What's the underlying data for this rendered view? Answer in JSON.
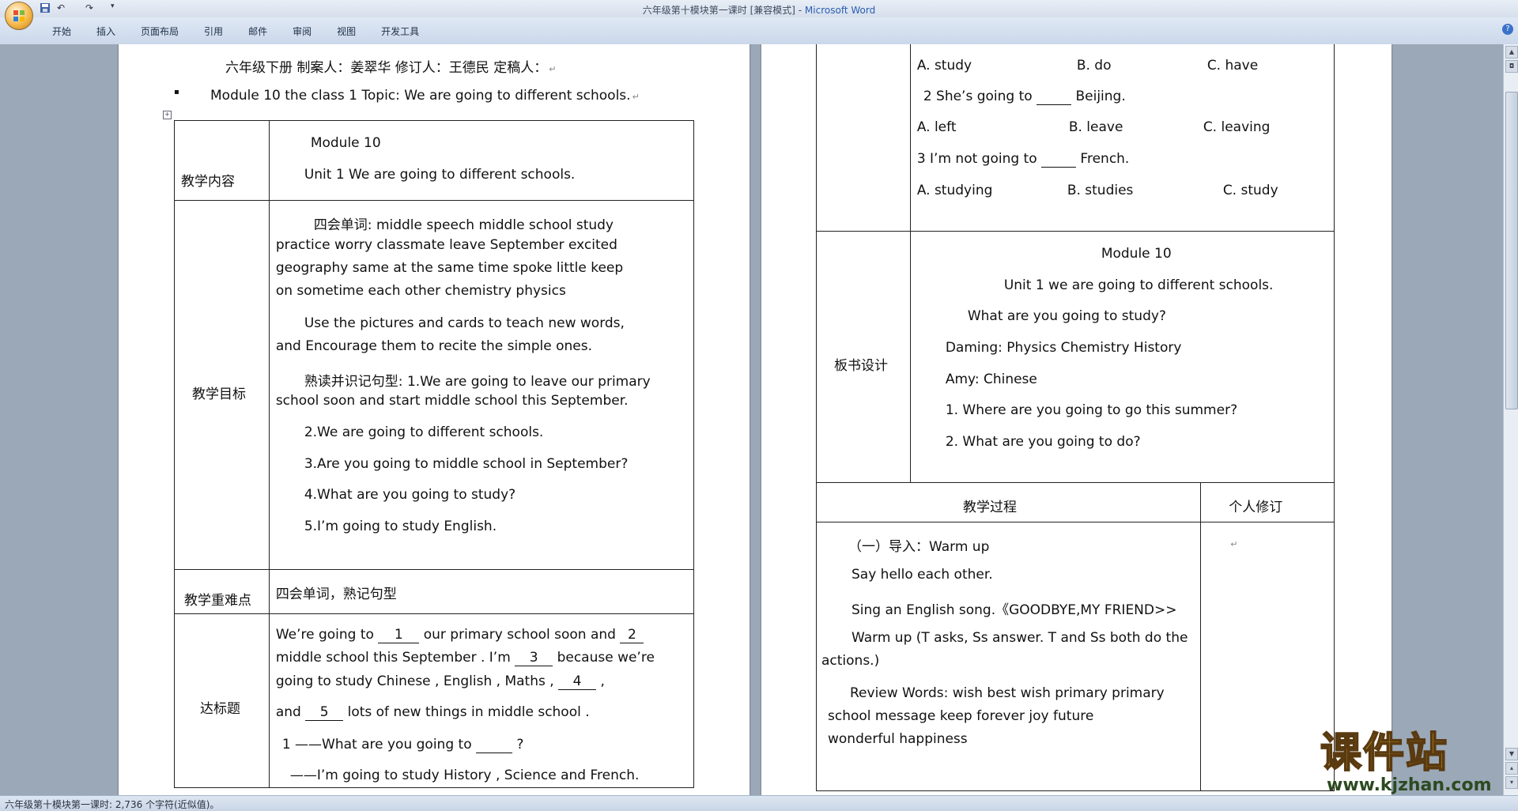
{
  "window": {
    "title": "六年级第十模块第一课时 [兼容模式] - ",
    "app_name": "Microsoft Word"
  },
  "ribbon": {
    "tabs": [
      "开始",
      "插入",
      "页面布局",
      "引用",
      "邮件",
      "审阅",
      "视图",
      "开发工具"
    ]
  },
  "page1": {
    "header_line": "六年级下册   制案人：姜翠华   修订人：王德民          定稿人：",
    "bullet": "▪",
    "module_line": "Module 10    the class 1    Topic: We are going to different schools.",
    "rows": {
      "content_label": "教学内容",
      "content_module": "Module 10",
      "content_unit": "Unit 1 We are going to different schools.",
      "goal_label": "教学目标",
      "goal_p1": [
        "四会单词: middle  speech   middle school    study",
        "practice     worry  classmate    leave    September  excited",
        "geography    same   at the same time    spoke     little   keep",
        "on   sometime   each other   chemistry   physics"
      ],
      "goal_p2": [
        "Use  the  pictures   and   cards   to   teach   new   words,",
        "and   Encourage   them   to   recite   the   simple   ones."
      ],
      "goal_p3": [
        "熟读并识记句型: 1.We  are  going  to  leave  our  primary",
        "school soon and start middle school this September."
      ],
      "goal_s2": "2.We are going to different schools.",
      "goal_s3": "3.Are you going to middle school in September?",
      "goal_s4": "4.What are you going to study?",
      "goal_s5": "5.I’m going to study English.",
      "key_label": "教学重难点",
      "key_text": "四会单词，熟记句型",
      "test_label": "达标题",
      "test_l1a": "We’re  going  to",
      "test_b1": "1",
      "test_l1b": "our  primary  school  soon  and",
      "test_b2": "2",
      "test_l2a": "middle  school  this  September . I’m",
      "test_b3": "3",
      "test_l2b": "because  we’re",
      "test_l3a": "going to study Chinese , English , Maths ,",
      "test_b4": "4",
      "test_l3b": ",",
      "test_l4a": "and",
      "test_b5": "5",
      "test_l4b": "lots of new things in middle school .",
      "q1": "1    ——What are you going to",
      "q1_end": "?",
      "q1_ans": "——I’m going to study History , Science and French."
    }
  },
  "page2": {
    "options1": {
      "a": "A.   study",
      "b": "B. do",
      "c": "C.    have"
    },
    "q2a": "2    She’s going to",
    "q2b": "Beijing.",
    "options2": {
      "a": "A.   left",
      "b": "B. leave",
      "c": "C.    leaving"
    },
    "q3a": "3    I’m not going to",
    "q3b": "French.",
    "options3": {
      "a": "A.   studying",
      "b": "B.    studies",
      "c": "C.    study"
    },
    "board_label": "板书设计",
    "board": {
      "l1": "Module 10",
      "l2": "Unit 1 we are going to different schools.",
      "l3": "What are you going to study?",
      "l4": "Daming:  Physics     Chemistry   History",
      "l5": "Amy: Chinese",
      "l6": "1. Where are you going to go this summer?",
      "l7": "2. What are you going to do?"
    },
    "process_label": "教学过程",
    "revise_label": "个人修订",
    "process": {
      "p1": "（一）导入：Warm up",
      "p2": "Say hello each other.",
      "p3": "Sing an English song.《GOODBYE,MY FRIEND>>",
      "p4a": "Warm up (T asks, Ss answer.     T and Ss both do the",
      "p4b": "actions.)",
      "p5a": "Review  Words:    wish  best  wish     primary  primary",
      "p5b": "school       message   keep          forever        joy         future",
      "p5c": "wonderful    happiness"
    }
  },
  "status": {
    "text": "六年级第十模块第一课时: 2,736 个字符(近似值)。"
  },
  "watermark": {
    "cn": "课件站",
    "url": "www.kjzhan.com"
  },
  "marks": {
    "para": "↵"
  }
}
